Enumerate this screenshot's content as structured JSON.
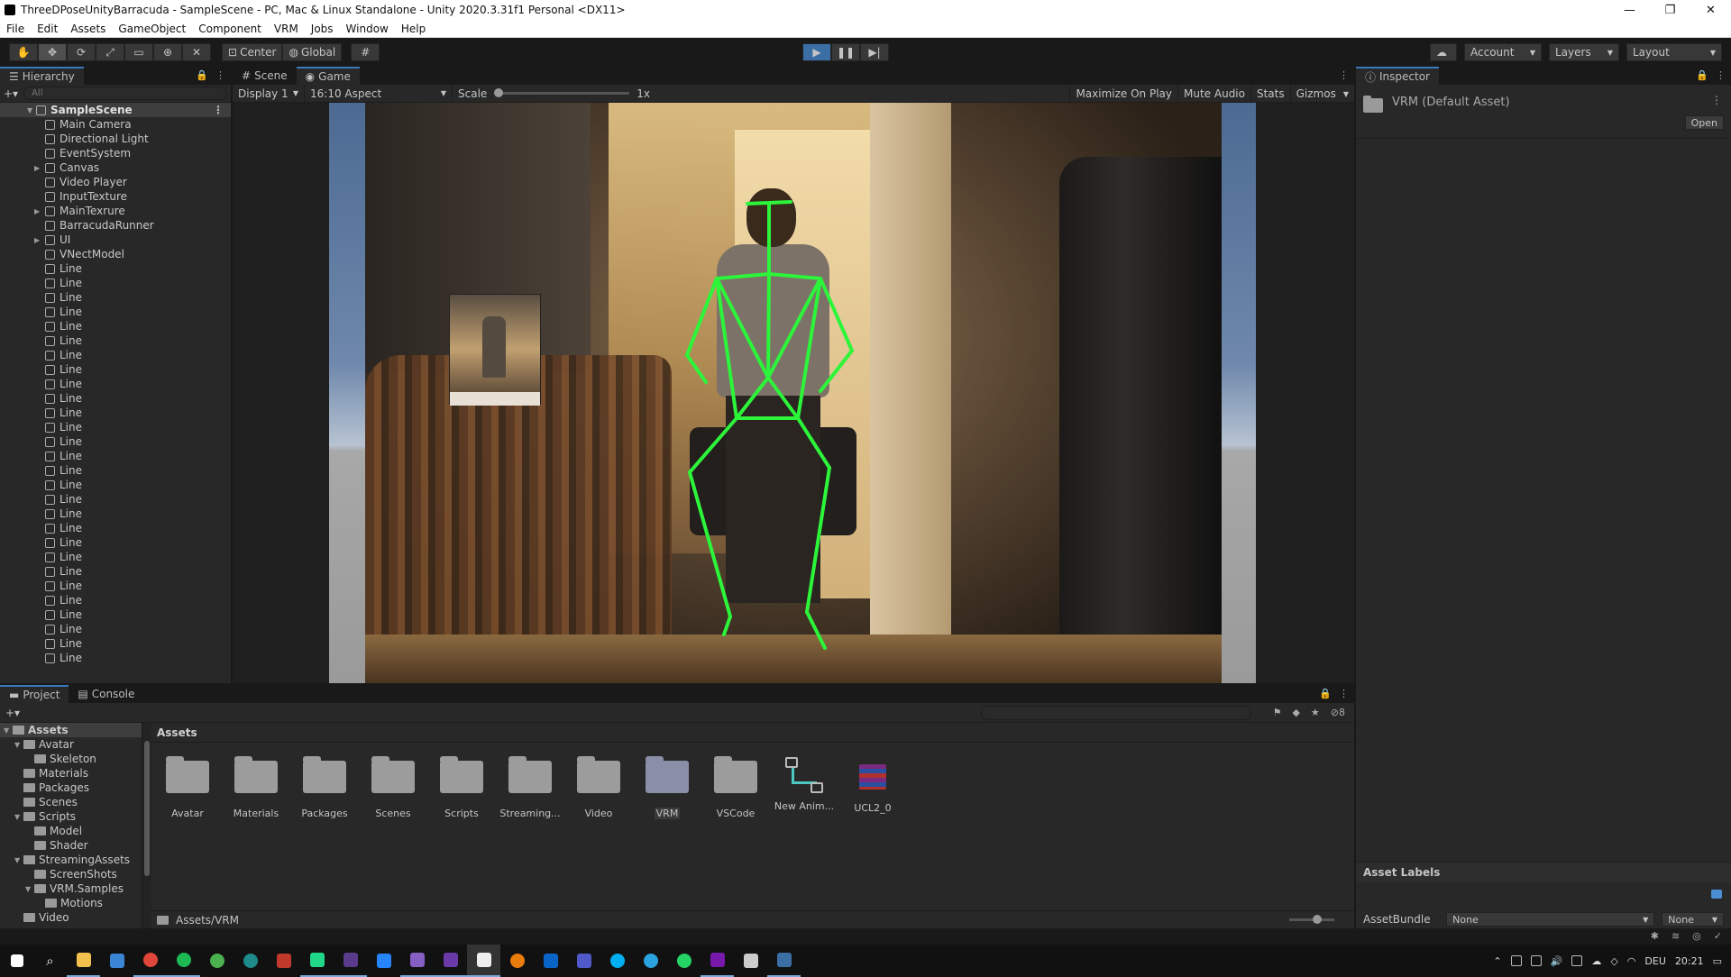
{
  "window": {
    "title": "ThreeDPoseUnityBarracuda - SampleScene - PC, Mac & Linux Standalone - Unity 2020.3.31f1 Personal <DX11>",
    "minimize": "—",
    "maximize": "❐",
    "close": "✕"
  },
  "menu": [
    "File",
    "Edit",
    "Assets",
    "GameObject",
    "Component",
    "VRM",
    "Jobs",
    "Window",
    "Help"
  ],
  "toolbar": {
    "pivot_center": "Center",
    "pivot_global": "Global",
    "account": "Account",
    "layers": "Layers",
    "layout": "Layout"
  },
  "hierarchy": {
    "tab": "Hierarchy",
    "search_placeholder": "All",
    "scene": "SampleScene",
    "items": [
      {
        "name": "Main Camera",
        "expandable": false
      },
      {
        "name": "Directional Light",
        "expandable": false
      },
      {
        "name": "EventSystem",
        "expandable": false
      },
      {
        "name": "Canvas",
        "expandable": true
      },
      {
        "name": "Video Player",
        "expandable": false
      },
      {
        "name": "InputTexture",
        "expandable": false
      },
      {
        "name": "MainTexrure",
        "expandable": true
      },
      {
        "name": "BarracudaRunner",
        "expandable": false
      },
      {
        "name": "UI",
        "expandable": true
      },
      {
        "name": "VNectModel",
        "expandable": false
      },
      {
        "name": "Line"
      },
      {
        "name": "Line"
      },
      {
        "name": "Line"
      },
      {
        "name": "Line"
      },
      {
        "name": "Line"
      },
      {
        "name": "Line"
      },
      {
        "name": "Line"
      },
      {
        "name": "Line"
      },
      {
        "name": "Line"
      },
      {
        "name": "Line"
      },
      {
        "name": "Line"
      },
      {
        "name": "Line"
      },
      {
        "name": "Line"
      },
      {
        "name": "Line"
      },
      {
        "name": "Line"
      },
      {
        "name": "Line"
      },
      {
        "name": "Line"
      },
      {
        "name": "Line"
      },
      {
        "name": "Line"
      },
      {
        "name": "Line"
      },
      {
        "name": "Line"
      },
      {
        "name": "Line"
      },
      {
        "name": "Line"
      },
      {
        "name": "Line"
      },
      {
        "name": "Line"
      },
      {
        "name": "Line"
      },
      {
        "name": "Line"
      },
      {
        "name": "Line"
      }
    ]
  },
  "game": {
    "tab_scene": "Scene",
    "tab_game": "Game",
    "display": "Display 1",
    "aspect": "16:10 Aspect",
    "scale_label": "Scale",
    "scale_value": "1x",
    "maximize": "Maximize On Play",
    "mute": "Mute Audio",
    "stats": "Stats",
    "gizmos": "Gizmos"
  },
  "inspector": {
    "tab": "Inspector",
    "asset_name": "VRM (Default Asset)",
    "open": "Open",
    "asset_labels": "Asset Labels",
    "asset_bundle": "AssetBundle",
    "bundle_value": "None",
    "variant_value": "None"
  },
  "project": {
    "tab_project": "Project",
    "tab_console": "Console",
    "hidden_count": "8",
    "tree": [
      {
        "name": "Assets",
        "depth": 0,
        "open": true,
        "selected": true
      },
      {
        "name": "Avatar",
        "depth": 1,
        "open": true
      },
      {
        "name": "Skeleton",
        "depth": 2
      },
      {
        "name": "Materials",
        "depth": 1
      },
      {
        "name": "Packages",
        "depth": 1
      },
      {
        "name": "Scenes",
        "depth": 1
      },
      {
        "name": "Scripts",
        "depth": 1,
        "open": true
      },
      {
        "name": "Model",
        "depth": 2
      },
      {
        "name": "Shader",
        "depth": 2
      },
      {
        "name": "StreamingAssets",
        "depth": 1,
        "open": true
      },
      {
        "name": "ScreenShots",
        "depth": 2
      },
      {
        "name": "VRM.Samples",
        "depth": 2,
        "open": true
      },
      {
        "name": "Motions",
        "depth": 3
      },
      {
        "name": "Video",
        "depth": 1
      }
    ],
    "assets_header": "Assets",
    "assets": [
      {
        "label": "Avatar",
        "kind": "folder"
      },
      {
        "label": "Materials",
        "kind": "folder"
      },
      {
        "label": "Packages",
        "kind": "folder"
      },
      {
        "label": "Scenes",
        "kind": "folder"
      },
      {
        "label": "Scripts",
        "kind": "folder"
      },
      {
        "label": "Streaming...",
        "kind": "folder"
      },
      {
        "label": "Video",
        "kind": "folder"
      },
      {
        "label": "VRM",
        "kind": "folder-selected"
      },
      {
        "label": "VSCode",
        "kind": "folder"
      },
      {
        "label": "New Anim...",
        "kind": "animator"
      },
      {
        "label": "UCL2_0",
        "kind": "archive"
      }
    ],
    "path": "Assets/VRM"
  },
  "taskbar": {
    "language": "DEU",
    "time": "20:21"
  }
}
